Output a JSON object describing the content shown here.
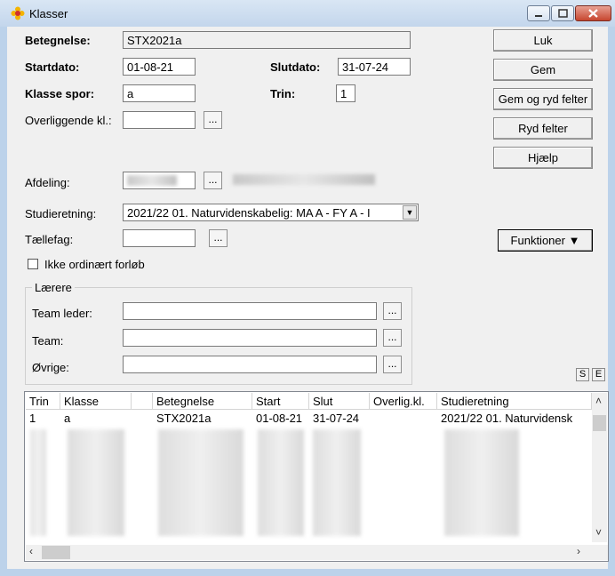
{
  "window": {
    "title": "Klasser",
    "icon": "flower-icon"
  },
  "form": {
    "betegnelse_label": "Betegnelse:",
    "betegnelse_value": "STX2021a",
    "startdato_label": "Startdato:",
    "startdato_value": "01-08-21",
    "slutdato_label": "Slutdato:",
    "slutdato_value": "31-07-24",
    "klassespor_label": "Klasse spor:",
    "klassespor_value": "a",
    "trin_label": "Trin:",
    "trin_value": "1",
    "overliggende_label": "Overliggende kl.:",
    "overliggende_value": "",
    "afdeling_label": "Afdeling:",
    "studieretning_label": "Studieretning:",
    "studieretning_value": "2021/22 01. Naturvidenskabelig: MA A - FY A - I",
    "taellefag_label": "Tællefag:",
    "taellefag_value": "",
    "ikke_ordinaert_label": "Ikke ordinært forløb",
    "browse_label": "..."
  },
  "laerere": {
    "legend": "Lærere",
    "teamleder_label": "Team leder:",
    "team_label": "Team:",
    "ovrige_label": "Øvrige:"
  },
  "buttons": {
    "luk": "Luk",
    "gem": "Gem",
    "gem_ryd": "Gem og ryd felter",
    "ryd": "Ryd felter",
    "hjaelp": "Hjælp",
    "funktioner": "Funktioner ▼",
    "s": "S",
    "e": "E"
  },
  "table": {
    "columns": [
      "Trin",
      "Klasse",
      "",
      "Betegnelse",
      "Start",
      "Slut",
      "Overlig.kl.",
      "Studieretning"
    ],
    "rows": [
      [
        "1",
        "a",
        "",
        "STX2021a",
        "01-08-21",
        "31-07-24",
        "",
        "2021/22 01. Naturvidensk"
      ]
    ]
  },
  "colors": {
    "titlebar": "#c9dbef",
    "close": "#c7462f",
    "dialog": "#f0f0f0"
  }
}
